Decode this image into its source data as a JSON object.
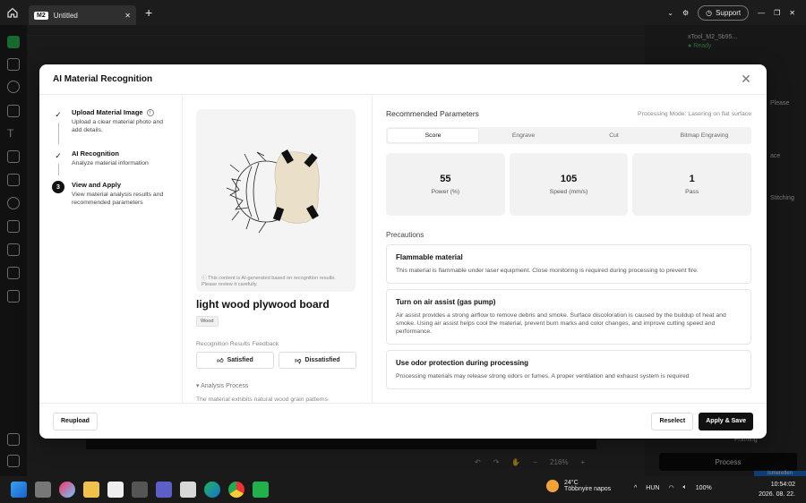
{
  "window": {
    "tab_badge": "M2",
    "tab_title": "Untitled",
    "support_label": "Support"
  },
  "app": {
    "device_name": "xTool_M2_5b95...",
    "device_status": "Ready",
    "right_snippets": [
      "Please",
      "ace",
      "Stitching",
      "Framing"
    ],
    "process_label": "Process",
    "zoom": "216%",
    "blue_hint": "Ismeretlen"
  },
  "dialog": {
    "title": "AI Material Recognition",
    "steps": [
      {
        "title": "Upload Material Image",
        "desc": "Upload a clear material photo and add details.",
        "state": "done"
      },
      {
        "title": "AI Recognition",
        "desc": "Analyze material information",
        "state": "done"
      },
      {
        "number": "3",
        "title": "View and Apply",
        "desc": "View material analysis results and recommended parameters",
        "state": "active"
      }
    ],
    "ai_note": "This content is AI-generated based on recognition results. Please review it carefully.",
    "material_name": "light wood plywood board",
    "material_tag": "Wood",
    "feedback_label": "Recognition Results Feedback",
    "satisfied_label": "Satisfied",
    "dissatisfied_label": "Dissatisfied",
    "analysis_label": "Analysis Process",
    "analysis_text": "The material exhibits natural wood grain patterns",
    "recommended_title": "Recommended Parameters",
    "processing_mode": "Processing Mode: Lasering on flat surface",
    "tabs": [
      "Score",
      "Engrave",
      "Cut",
      "Bitmap Engraving"
    ],
    "active_tab": "Score",
    "params": [
      {
        "value": "55",
        "label": "Power (%)"
      },
      {
        "value": "105",
        "label": "Speed (mm/s)"
      },
      {
        "value": "1",
        "label": "Pass"
      }
    ],
    "precautions_title": "Precautions",
    "precautions": [
      {
        "title": "Flammable material",
        "text": "This material is flammable under laser equipment. Close monitoring is required during processing to prevent fire."
      },
      {
        "title": "Turn on air assist (gas pump)",
        "text": "Air assist provides a strong airflow to remove debris and smoke. Surface discoloration is caused by the buildup of heat and smoke. Using air assist helps cool the material, prevent burn marks and color changes, and improve cutting speed and performance."
      },
      {
        "title": "Use odor protection during processing",
        "text": "Processing materials may release strong odors or fumes. A proper ventilation and exhaust system is required"
      }
    ],
    "reupload_label": "Reupload",
    "reselect_label": "Reselect",
    "apply_label": "Apply & Save"
  },
  "taskbar": {
    "temperature": "24°C",
    "weather": "Többnyire napos",
    "language": "HUN",
    "battery": "100%",
    "time": "10:54:02",
    "date": "2026. 08. 22."
  }
}
